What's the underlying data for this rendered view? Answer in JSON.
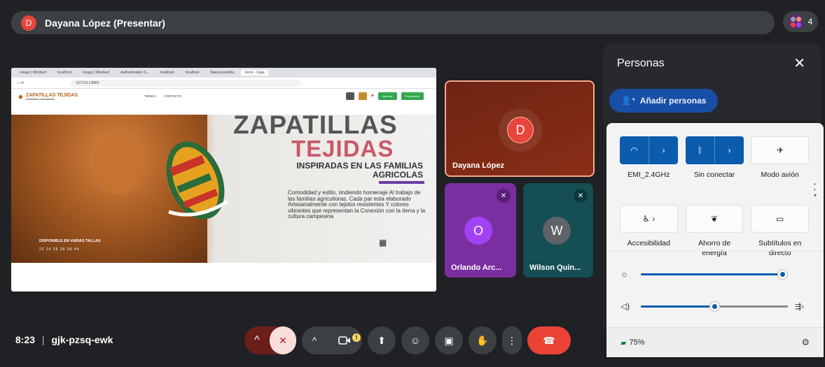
{
  "presenter": {
    "initial": "D",
    "title": "Dayana López (Presentar)"
  },
  "participants_count": "4",
  "browser": {
    "tabs": [
      "Usage | Windsurf",
      "localhost",
      "Usage | Windsurf",
      "Authentication S...",
      "localhost",
      "localhost",
      "Nueva pestaña",
      "Inicio - Zapa"
    ],
    "url": "127.0.0.1:8001"
  },
  "site": {
    "brand": "ZAPATILLAS TEJIDAS",
    "brand_sub": "Artesanías Colombianas",
    "nav": [
      "TIENDA",
      "CONTACTO"
    ],
    "login": "Ingresar",
    "register": "Registrarse",
    "title1": "ZAPATILLAS",
    "title2": "TEJIDAS",
    "subtitle": "INSPIRADAS EN LAS FAMILIAS AGRICOLAS",
    "description": "Comodidad y estilo, rindiendo homenaje Al trabajo de las familias agricultoras. Cada par esta elaborado Artesanalmente con tejidos resistentes Y colores vibrantes que representan la Conexión con la tierra y la cultura campesina",
    "available": "DISPONIBLE EN VARIAS TALLAS",
    "sizes": "22 24 26 28 36 44"
  },
  "tiles": {
    "main": {
      "initial": "D",
      "name": "Dayana López"
    },
    "orlando": {
      "initial": "O",
      "name": "Orlando Arc..."
    },
    "wilson": {
      "initial": "W",
      "name": "Wilson Quin..."
    }
  },
  "meeting": {
    "time": "8:23",
    "separator": "|",
    "code": "gjk-pzsq-ewk"
  },
  "people_panel": {
    "title": "Personas",
    "add_label": "Añadir personas"
  },
  "quick_settings": {
    "wifi_label": "EMI_2.4GHz",
    "bluetooth_label": "Sin conectar",
    "airplane_label": "Modo avión",
    "accessibility_label": "Accesibilidad",
    "energy_label": "Ahorro de energía",
    "captions_label": "Subtítulos en directo",
    "brightness": 0.96,
    "volume": 0.5,
    "battery": "75%"
  },
  "colors": {
    "accent": "#0b5cad",
    "hangup": "#ea4335",
    "presenter": "#e8453c"
  }
}
